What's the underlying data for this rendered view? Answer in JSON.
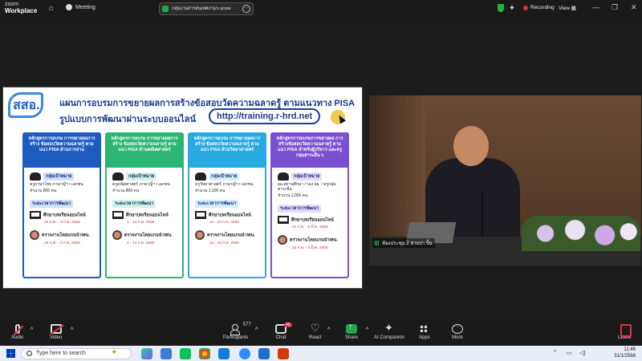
{
  "app": {
    "brand_line1": "zoom",
    "brand_line2": "Workplace",
    "meeting_label": "Meeting"
  },
  "share": {
    "label": "กลุ่มงานสารสนเทศงาน's scree"
  },
  "status": {
    "recording": "Recording",
    "view": "View"
  },
  "slide": {
    "logo": "สสอ.",
    "title1": "แผนการอบรมการขยายผลการสร้างข้อสอบวัดความฉลาดรู้ ตามแนวทาง PISA",
    "title2": "รูปแบบการพัฒนาผ่านระบบออนไลน์",
    "url": "http://training.r-hrd.net",
    "columns": [
      {
        "head": "หลักสูตรการอบรม การขยายผลการสร้าง ข้อสอบวัดความฉลาดรู้ ตามแนว PISA ด้านการอ่าน",
        "target_tag": "กลุ่มเป้าหมาย",
        "target_text": "ครูภาษาไทย ภาษาญี่ฯ • เอกชน",
        "target_count": "จำนวน 800 คน",
        "period_tag": "ระยะเวลาการพัฒนา",
        "study": "ศึกษาบทเรียนออนไลน์",
        "study_date": "25 ม.ค. - 3 ก.พ. 2568",
        "check": "ตรวจงานโดยแกนนำ/ศน.",
        "check_date": "25 ม.ค. - 3 ก.พ. 2568"
      },
      {
        "head": "หลักสูตรการอบรม การขยายผลการสร้าง ข้อสอบวัดความฉลาดรู้ ตามแนว PISA ด้านคณิตศาสตร์",
        "target_tag": "กลุ่มเป้าหมาย",
        "target_text": "ครูคณิตศาสตร์ ภาษาญี่ฯ • เอกชน",
        "target_count": "จำนวน 800 คน",
        "period_tag": "ระยะเวลาการพัฒนา",
        "study": "ศึกษาบทเรียนออนไลน์",
        "study_date": "4 - 13 ก.พ. 2568",
        "check": "ตรวจงานโดยแกนนำ/ศน.",
        "check_date": "4 - 13 ก.พ. 2568"
      },
      {
        "head": "หลักสูตรการอบรม การขยายผลการสร้าง ข้อสอบวัดความฉลาดรู้ ตามแนว PISA ด้านวิทยาศาสตร์",
        "target_tag": "กลุ่มเป้าหมาย",
        "target_text": "ครูวิทยาศาสตร์ ภาษาญี่ฯ • เอกชน",
        "target_count": "จำนวน 1,100 คน",
        "period_tag": "ระยะเวลาการพัฒนา",
        "study": "ศึกษาบทเรียนออนไลน์",
        "study_date": "14 - 23 ก.พ. 2568",
        "check": "ตรวจงานโดยแกนนำ/ศน.",
        "check_date": "14 - 23 ก.พ. 2568"
      },
      {
        "head": "หลักสูตรการอบรมการขยายผล การสร้างข้อสอบวัดความฉลาดรู้ ตามแนว PISA สำหรับผู้บริหาร และครูกลุ่มสาระอื่น ๆ",
        "target_tag": "กลุ่มเป้าหมาย",
        "target_text": "ผอ.สถานศึกษา / รอง ผอ. / ครูกลุ่มสาระอื่น",
        "target_count": "จำนวน 1,000 คน",
        "period_tag": "ระยะเวลาการพัฒนา",
        "study": "ศึกษาบทเรียนออนไลน์",
        "study_date": "24 ก.พ. - 5 มี.ค. 2568",
        "check": "ตรวจงานโดยแกนนำ/ศน.",
        "check_date": "24 ก.พ. - 5 มี.ค. 2568"
      }
    ]
  },
  "video": {
    "caption": "ห้องประชุม 2 สายปา ปั้น"
  },
  "toolbar": {
    "audio": "Audio",
    "video": "Video",
    "participants": "Participants",
    "participants_count": "577",
    "chat": "Chat",
    "chat_badge": "45",
    "react": "React",
    "share": "Share",
    "ai": "AI Companion",
    "apps": "Apps",
    "more": "More",
    "leave": "Leave"
  },
  "taskbar": {
    "search_placeholder": "Type here to search",
    "time": "11:46",
    "date": "31/1/2568"
  },
  "colors": {
    "col1": "#1e5bbf",
    "col2": "#2bb673",
    "col3": "#27a9e1",
    "col4": "#7b4fd1",
    "recording": "#e0334b",
    "share_green": "#1fa74a"
  }
}
